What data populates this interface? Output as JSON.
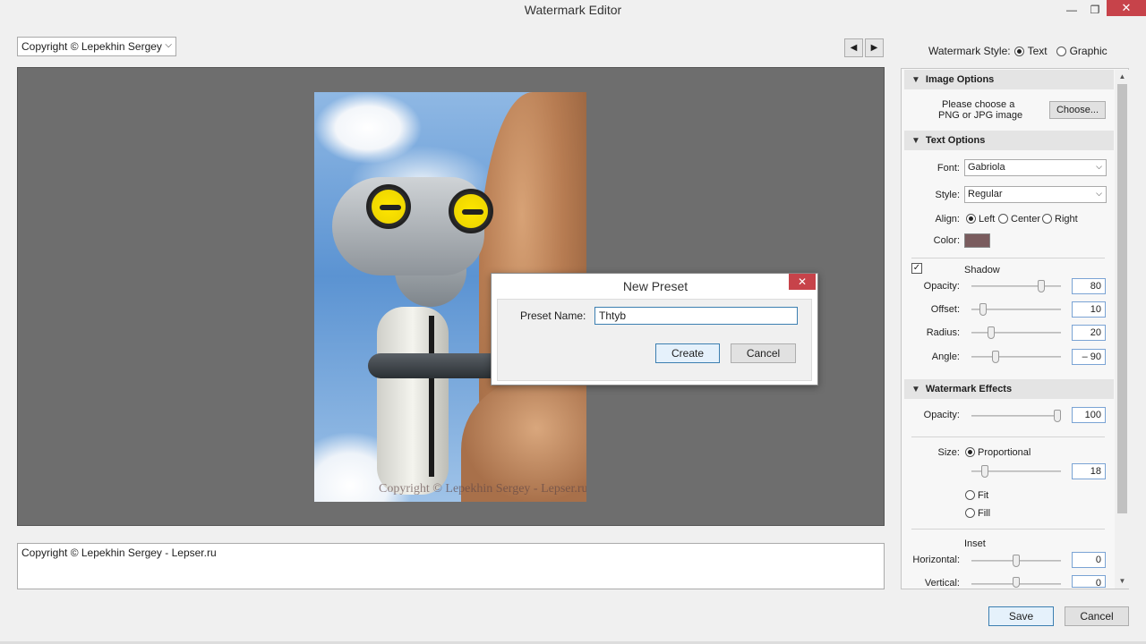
{
  "window": {
    "title": "Watermark Editor",
    "minimize": "—",
    "maximize": "❐",
    "close": "✕"
  },
  "toolbar": {
    "preset_value": "Copyright © Lepekhin Sergey",
    "prev": "◀",
    "next": "▶",
    "watermark_style_label": "Watermark Style:",
    "style_text": "Text",
    "style_graphic": "Graphic"
  },
  "preview": {
    "watermark_text": "Copyright © Lepekhin Sergey - Lepser.ru"
  },
  "text_input": {
    "value": "Copyright © Lepekhin Sergey - Lepser.ru"
  },
  "image_options": {
    "header": "Image Options",
    "prompt_line1": "Please choose a",
    "prompt_line2": "PNG or JPG image",
    "choose_label": "Choose..."
  },
  "text_options": {
    "header": "Text Options",
    "font_label": "Font:",
    "font_value": "Gabriola",
    "style_label": "Style:",
    "style_value": "Regular",
    "align_label": "Align:",
    "align_left": "Left",
    "align_center": "Center",
    "align_right": "Right",
    "color_label": "Color:",
    "color_value": "#7a5c5e"
  },
  "shadow": {
    "label": "Shadow",
    "checked": "✓",
    "opacity_label": "Opacity:",
    "opacity_value": "80",
    "opacity_pct": 80,
    "offset_label": "Offset:",
    "offset_value": "10",
    "offset_pct": 10,
    "radius_label": "Radius:",
    "radius_value": "20",
    "radius_pct": 20,
    "angle_label": "Angle:",
    "angle_value": "– 90",
    "angle_pct": 25
  },
  "effects": {
    "header": "Watermark Effects",
    "opacity_label": "Opacity:",
    "opacity_value": "100",
    "opacity_pct": 100,
    "size_label": "Size:",
    "size_proportional": "Proportional",
    "size_value": "18",
    "size_pct": 12,
    "size_fit": "Fit",
    "size_fill": "Fill",
    "inset_label": "Inset",
    "horizontal_label": "Horizontal:",
    "horizontal_value": "0",
    "horizontal_pct": 50,
    "vertical_label": "Vertical:",
    "vertical_value": "0",
    "vertical_pct": 50
  },
  "dialog": {
    "title": "New Preset",
    "close": "✕",
    "preset_name_label": "Preset Name:",
    "preset_name_value": "Thtyb",
    "create_label": "Create",
    "cancel_label": "Cancel"
  },
  "footer": {
    "save_label": "Save",
    "cancel_label": "Cancel"
  },
  "colors": {
    "accent": "#3c7fb1",
    "close": "#c7434a"
  }
}
